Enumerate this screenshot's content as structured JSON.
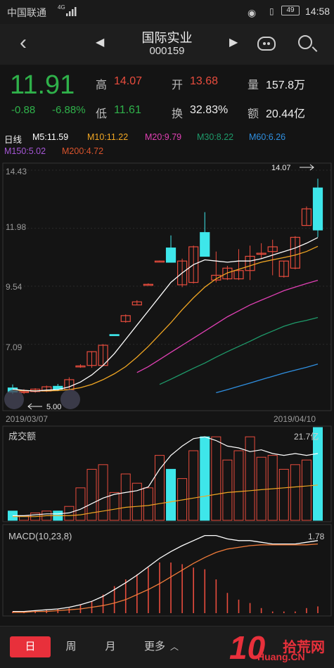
{
  "status_bar": {
    "carrier": "中国联通",
    "network": "4G",
    "battery": "49",
    "time": "14:58"
  },
  "header": {
    "stock_name": "国际实业",
    "stock_code": "000159"
  },
  "quote": {
    "price": "11.91",
    "change": "-0.88",
    "change_pct": "-6.88%",
    "high_label": "高",
    "high": "14.07",
    "low_label": "低",
    "low": "11.61",
    "open_label": "开",
    "open": "13.68",
    "turnover_label": "换",
    "turnover": "32.83%",
    "volume_label": "量",
    "volume": "157.8万",
    "amount_label": "额",
    "amount": "20.44亿"
  },
  "ma_legend": {
    "period": "日线",
    "ma5": "M5:11.59",
    "ma10": "M10:11.22",
    "ma20": "M20:9.79",
    "ma30": "M30:8.22",
    "ma60": "M60:6.26",
    "ma150": "M150:5.02",
    "ma200": "M200:4.72"
  },
  "colors": {
    "up": "#e84c3d",
    "down": "#3ee6ea",
    "ma5": "#ffffff",
    "ma10": "#f0a623",
    "ma20": "#e040b4",
    "ma30": "#1e9a6a",
    "ma60": "#2f8fe0",
    "ma150": "#a556d6",
    "ma200": "#d9532c"
  },
  "chart_data": [
    {
      "type": "candlestick",
      "title": "日线",
      "y_ticks": [
        "14.43",
        "11.98",
        "9.54",
        "7.09"
      ],
      "ylim": [
        4.65,
        14.43
      ],
      "x_start_label": "2019/03/07",
      "x_end_label": "2019/04/10",
      "max_marker": "14.07",
      "min_marker": "5.00",
      "candles": [
        {
          "o": 5.25,
          "h": 5.4,
          "l": 5.0,
          "c": 5.08
        },
        {
          "o": 5.08,
          "h": 5.2,
          "l": 5.0,
          "c": 5.1
        },
        {
          "o": 5.1,
          "h": 5.24,
          "l": 5.05,
          "c": 5.2
        },
        {
          "o": 5.12,
          "h": 5.35,
          "l": 5.08,
          "c": 5.3
        },
        {
          "o": 5.32,
          "h": 5.42,
          "l": 5.12,
          "c": 5.2
        },
        {
          "o": 5.18,
          "h": 5.7,
          "l": 5.15,
          "c": 5.6
        },
        {
          "o": 6.15,
          "h": 6.25,
          "l": 6.1,
          "c": 6.18
        },
        {
          "o": 6.2,
          "h": 6.8,
          "l": 6.1,
          "c": 6.78
        },
        {
          "o": 6.2,
          "h": 7.1,
          "l": 6.2,
          "c": 7.05
        },
        {
          "o": 7.5,
          "h": 7.5,
          "l": 7.45,
          "c": 7.47
        },
        {
          "o": 8.05,
          "h": 8.35,
          "l": 8.0,
          "c": 8.3
        },
        {
          "o": 8.75,
          "h": 8.95,
          "l": 8.75,
          "c": 8.88
        },
        {
          "o": 9.62,
          "h": 9.66,
          "l": 9.6,
          "c": 9.62
        },
        {
          "o": 10.6,
          "h": 10.62,
          "l": 10.58,
          "c": 10.6
        },
        {
          "o": 11.15,
          "h": 11.68,
          "l": 10.55,
          "c": 10.55
        },
        {
          "o": 9.6,
          "h": 10.7,
          "l": 9.5,
          "c": 10.6
        },
        {
          "o": 9.7,
          "h": 11.25,
          "l": 9.65,
          "c": 11.2
        },
        {
          "o": 11.8,
          "h": 12.66,
          "l": 10.8,
          "c": 10.8
        },
        {
          "o": 9.8,
          "h": 11.0,
          "l": 9.7,
          "c": 10.0
        },
        {
          "o": 9.85,
          "h": 10.4,
          "l": 9.8,
          "c": 10.3
        },
        {
          "o": 9.85,
          "h": 11.1,
          "l": 9.8,
          "c": 10.2
        },
        {
          "o": 10.2,
          "h": 11.25,
          "l": 9.8,
          "c": 10.8
        },
        {
          "o": 10.9,
          "h": 11.35,
          "l": 10.7,
          "c": 10.93
        },
        {
          "o": 11.0,
          "h": 11.5,
          "l": 10.0,
          "c": 11.2
        },
        {
          "o": 9.95,
          "h": 10.6,
          "l": 9.9,
          "c": 10.6
        },
        {
          "o": 10.3,
          "h": 11.65,
          "l": 10.25,
          "c": 11.6
        },
        {
          "o": 12.1,
          "h": 12.9,
          "l": 12.1,
          "c": 12.8
        },
        {
          "o": 13.68,
          "h": 14.07,
          "l": 11.61,
          "c": 11.91
        }
      ],
      "ma5": [
        5.2,
        5.15,
        5.12,
        5.16,
        5.18,
        5.3,
        5.5,
        5.8,
        6.2,
        6.7,
        7.3,
        7.9,
        8.5,
        9.1,
        9.7,
        10.1,
        10.45,
        10.65,
        10.6,
        10.55,
        10.6,
        10.6,
        10.7,
        10.85,
        11.0,
        11.15,
        11.35,
        11.59
      ],
      "ma10": [
        5.15,
        5.14,
        5.13,
        5.13,
        5.14,
        5.18,
        5.26,
        5.4,
        5.6,
        5.85,
        6.15,
        6.55,
        7.0,
        7.5,
        8.0,
        8.55,
        9.05,
        9.5,
        9.85,
        10.1,
        10.25,
        10.4,
        10.55,
        10.65,
        10.75,
        10.85,
        11.0,
        11.22
      ],
      "ma20": [
        null,
        null,
        null,
        null,
        null,
        null,
        null,
        null,
        null,
        null,
        null,
        5.9,
        6.15,
        6.45,
        6.75,
        7.05,
        7.35,
        7.65,
        7.95,
        8.25,
        8.5,
        8.75,
        8.95,
        9.15,
        9.35,
        9.5,
        9.65,
        9.79
      ],
      "ma30": [
        null,
        null,
        null,
        null,
        null,
        null,
        null,
        null,
        null,
        null,
        null,
        null,
        null,
        5.4,
        5.62,
        5.85,
        6.08,
        6.3,
        6.55,
        6.78,
        7.0,
        7.22,
        7.45,
        7.65,
        7.85,
        8.0,
        8.1,
        8.22
      ],
      "ma60": [
        null,
        null,
        null,
        null,
        null,
        null,
        null,
        null,
        null,
        null,
        null,
        null,
        null,
        null,
        null,
        null,
        null,
        null,
        5.05,
        5.18,
        5.32,
        5.46,
        5.6,
        5.74,
        5.88,
        6.0,
        6.12,
        6.26
      ]
    },
    {
      "type": "bar",
      "title": "成交额",
      "max_label": "21.7亿",
      "values": [
        0.1,
        0.05,
        0.08,
        0.1,
        0.1,
        0.15,
        0.35,
        0.55,
        0.6,
        0.3,
        0.5,
        0.4,
        0.35,
        0.7,
        0.55,
        0.45,
        0.75,
        0.9,
        0.9,
        0.65,
        0.75,
        0.9,
        0.68,
        0.7,
        0.55,
        0.6,
        0.65,
        1.0
      ],
      "up": [
        false,
        true,
        true,
        true,
        false,
        true,
        true,
        true,
        true,
        true,
        true,
        true,
        true,
        true,
        false,
        true,
        true,
        false,
        true,
        true,
        true,
        true,
        true,
        true,
        true,
        true,
        true,
        false
      ],
      "ma_white": [
        0.05,
        0.05,
        0.06,
        0.07,
        0.07,
        0.08,
        0.12,
        0.18,
        0.24,
        0.28,
        0.3,
        0.32,
        0.36,
        0.55,
        0.7,
        0.8,
        0.88,
        0.9,
        0.86,
        0.8,
        0.78,
        0.74,
        0.76,
        0.72,
        0.7,
        0.72,
        0.7,
        0.72
      ],
      "ma_yellow": [
        0.04,
        0.04,
        0.04,
        0.05,
        0.05,
        0.05,
        0.06,
        0.08,
        0.1,
        0.12,
        0.14,
        0.15,
        0.16,
        0.18,
        0.2,
        0.22,
        0.24,
        0.26,
        0.28,
        0.3,
        0.31,
        0.32,
        0.33,
        0.34,
        0.35,
        0.36,
        0.37,
        0.38
      ]
    },
    {
      "type": "bar",
      "title": "MACD(10,23,8)",
      "value_label": "1.78",
      "dif": [
        0.02,
        0.02,
        0.03,
        0.04,
        0.05,
        0.07,
        0.1,
        0.14,
        0.2,
        0.28,
        0.36,
        0.45,
        0.55,
        0.65,
        0.73,
        0.8,
        0.86,
        0.92,
        0.92,
        0.88,
        0.86,
        0.86,
        0.84,
        0.82,
        0.82,
        0.82,
        0.84,
        0.86
      ],
      "dea": [
        0.01,
        0.01,
        0.02,
        0.02,
        0.03,
        0.04,
        0.05,
        0.07,
        0.09,
        0.12,
        0.16,
        0.22,
        0.28,
        0.35,
        0.43,
        0.51,
        0.59,
        0.66,
        0.72,
        0.76,
        0.78,
        0.8,
        0.81,
        0.81,
        0.81,
        0.81,
        0.81,
        0.82
      ],
      "hist": [
        0.02,
        0.02,
        0.03,
        0.04,
        0.05,
        0.06,
        0.1,
        0.14,
        0.22,
        0.32,
        0.4,
        0.46,
        0.54,
        0.6,
        0.6,
        0.58,
        0.54,
        0.52,
        0.4,
        0.24,
        0.16,
        0.12,
        0.06,
        0.02,
        0.02,
        0.02,
        0.06,
        0.08
      ]
    }
  ],
  "toolbar": {
    "day": "日",
    "week": "周",
    "month": "月",
    "more": "更多"
  },
  "logo": {
    "mark": "10",
    "site": "拾荒网",
    "domain": "Huang.CN"
  }
}
